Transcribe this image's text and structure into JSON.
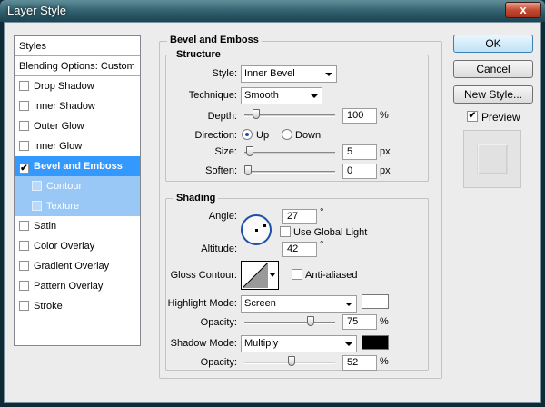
{
  "window": {
    "title": "Layer Style",
    "close": "x"
  },
  "styles_panel": {
    "header": "Styles",
    "items": [
      {
        "label": "Blending Options: Custom",
        "checkbox": false,
        "checked": false
      },
      {
        "label": "Drop Shadow",
        "checkbox": true,
        "checked": false
      },
      {
        "label": "Inner Shadow",
        "checkbox": true,
        "checked": false
      },
      {
        "label": "Outer Glow",
        "checkbox": true,
        "checked": false
      },
      {
        "label": "Inner Glow",
        "checkbox": true,
        "checked": false
      },
      {
        "label": "Bevel and Emboss",
        "checkbox": true,
        "checked": true,
        "selected": true
      },
      {
        "label": "Contour",
        "checkbox": true,
        "checked": false,
        "sub": true
      },
      {
        "label": "Texture",
        "checkbox": true,
        "checked": false,
        "sub": true
      },
      {
        "label": "Satin",
        "checkbox": true,
        "checked": false
      },
      {
        "label": "Color Overlay",
        "checkbox": true,
        "checked": false
      },
      {
        "label": "Gradient Overlay",
        "checkbox": true,
        "checked": false
      },
      {
        "label": "Pattern Overlay",
        "checkbox": true,
        "checked": false
      },
      {
        "label": "Stroke",
        "checkbox": true,
        "checked": false
      }
    ]
  },
  "bevel": {
    "title": "Bevel and Emboss",
    "structure": {
      "title": "Structure",
      "style_label": "Style:",
      "style_value": "Inner Bevel",
      "technique_label": "Technique:",
      "technique_value": "Smooth",
      "depth_label": "Depth:",
      "depth_value": "100",
      "depth_unit": "%",
      "depth_level": 0.1,
      "direction_label": "Direction:",
      "dir_up": "Up",
      "dir_down": "Down",
      "direction": "Up",
      "size_label": "Size:",
      "size_value": "5",
      "size_unit": "px",
      "size_level": 0.02,
      "soften_label": "Soften:",
      "soften_value": "0",
      "soften_unit": "px",
      "soften_level": 0.0
    },
    "shading": {
      "title": "Shading",
      "angle_label": "Angle:",
      "angle_value": "27",
      "angle_unit": "°",
      "global_light_label": "Use Global Light",
      "global_light": false,
      "altitude_label": "Altitude:",
      "altitude_value": "42",
      "altitude_unit": "°",
      "gloss_label": "Gloss Contour:",
      "antialiased_label": "Anti-aliased",
      "antialiased": false,
      "highlight_label": "Highlight Mode:",
      "highlight_value": "Screen",
      "highlight_color": "#ffffff",
      "hl_opacity_label": "Opacity:",
      "hl_opacity_value": "75",
      "hl_opacity_unit": "%",
      "hl_opacity_level": 0.75,
      "shadow_label": "Shadow Mode:",
      "shadow_value": "Multiply",
      "shadow_color": "#000000",
      "sh_opacity_label": "Opacity:",
      "sh_opacity_value": "52",
      "sh_opacity_unit": "%",
      "sh_opacity_level": 0.52
    }
  },
  "buttons": {
    "ok": "OK",
    "cancel": "Cancel",
    "new_style": "New Style...",
    "preview_label": "Preview",
    "preview": true
  }
}
